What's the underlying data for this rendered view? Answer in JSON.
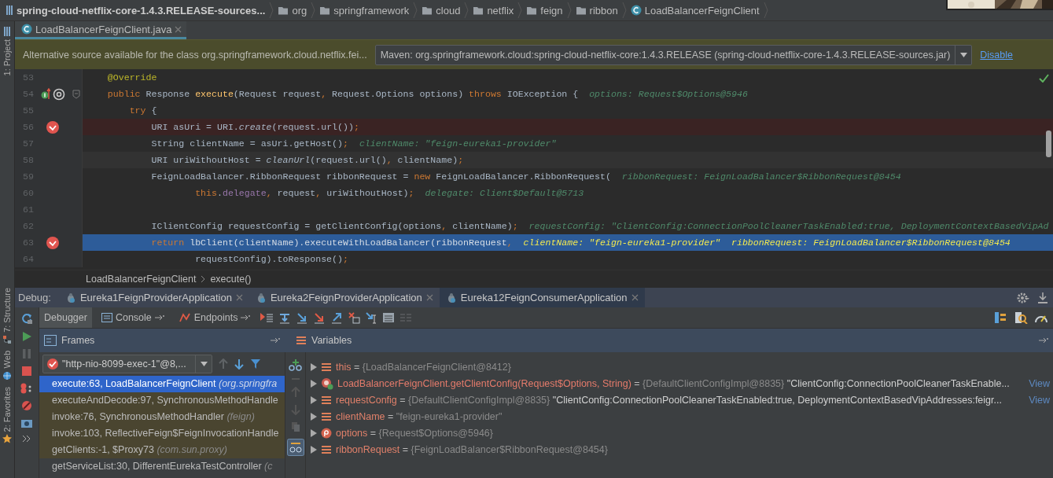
{
  "breadcrumb": [
    {
      "kind": "project",
      "label": "spring-cloud-netflix-core-1.4.3.RELEASE-sources..."
    },
    {
      "kind": "folder",
      "label": "org"
    },
    {
      "kind": "folder",
      "label": "springframework"
    },
    {
      "kind": "folder",
      "label": "cloud"
    },
    {
      "kind": "folder",
      "label": "netflix"
    },
    {
      "kind": "folder",
      "label": "feign"
    },
    {
      "kind": "folder",
      "label": "ribbon"
    },
    {
      "kind": "class",
      "label": "LoadBalancerFeignClient"
    }
  ],
  "tool_strip": [
    {
      "label": "1: Project",
      "kind": "project"
    },
    {
      "label": "7: Structure",
      "kind": "structure"
    },
    {
      "label": "Web",
      "kind": "web"
    },
    {
      "label": "2: Favorites",
      "kind": "favorites"
    }
  ],
  "editor_tabs": [
    {
      "label": "LoadBalancerFeignClient.java",
      "selected": true
    }
  ],
  "notification": {
    "message": "Alternative source available for the class org.springframework.cloud.netflix.fei...",
    "source": "Maven: org.springframework.cloud:spring-cloud-netflix-core:1.4.3.RELEASE (spring-cloud-netflix-core-1.4.3.RELEASE-sources.jar)",
    "action": "Disable"
  },
  "editor": {
    "lines": [
      {
        "number": "53",
        "kind": "code",
        "breakpoint": false,
        "current": false,
        "caret": false,
        "tokens": [
          {
            "kind": "annotation",
            "text": "    @Override"
          }
        ]
      },
      {
        "number": "54",
        "kind": "header",
        "breakpoint": false,
        "current": false,
        "caret": false,
        "tokens": [
          {
            "kind": "keyword",
            "text": "    public"
          },
          {
            "kind": "plain",
            "text": " Response "
          },
          {
            "kind": "declaration",
            "text": "execute"
          },
          {
            "kind": "plain",
            "text": "(Request request"
          },
          {
            "kind": "keyword",
            "text": ","
          },
          {
            "kind": "plain",
            "text": " Request.Options options) "
          },
          {
            "kind": "keyword",
            "text": "throws"
          },
          {
            "kind": "plain",
            "text": " IOException {"
          }
        ],
        "hints": [
          "options: Request$Options@5946"
        ]
      },
      {
        "number": "55",
        "kind": "code",
        "breakpoint": false,
        "current": false,
        "caret": false,
        "tokens": [
          {
            "kind": "keyword",
            "text": "        try"
          },
          {
            "kind": "plain",
            "text": " {"
          }
        ]
      },
      {
        "number": "56",
        "kind": "code",
        "breakpoint": true,
        "current": false,
        "caret": false,
        "tokens": [
          {
            "kind": "plain",
            "text": "            URI asUri = URI."
          },
          {
            "kind": "static",
            "text": "create"
          },
          {
            "kind": "plain",
            "text": "(request.url())"
          },
          {
            "kind": "keyword",
            "text": ";"
          }
        ]
      },
      {
        "number": "57",
        "kind": "code",
        "breakpoint": false,
        "current": false,
        "caret": false,
        "tokens": [
          {
            "kind": "plain",
            "text": "            String clientName = asUri.getHost()"
          },
          {
            "kind": "keyword",
            "text": ";"
          }
        ],
        "hints": [
          "clientName: \"feign-eureka1-provider\""
        ]
      },
      {
        "number": "58",
        "kind": "code",
        "breakpoint": false,
        "current": false,
        "caret": true,
        "tokens": [
          {
            "kind": "plain",
            "text": "            URI uriWithoutHost = "
          },
          {
            "kind": "static",
            "text": "cleanUrl"
          },
          {
            "kind": "plain",
            "text": "(request.url()"
          },
          {
            "kind": "keyword",
            "text": ","
          },
          {
            "kind": "plain",
            "text": " clientName)"
          },
          {
            "kind": "keyword",
            "text": ";"
          }
        ]
      },
      {
        "number": "59",
        "kind": "code",
        "breakpoint": false,
        "current": false,
        "caret": false,
        "tokens": [
          {
            "kind": "plain",
            "text": "            FeignLoadBalancer.RibbonRequest ribbonRequest = "
          },
          {
            "kind": "keyword",
            "text": "new"
          },
          {
            "kind": "plain",
            "text": " FeignLoadBalancer.RibbonRequest("
          }
        ],
        "hints": [
          "ribbonRequest: FeignLoadBalancer$RibbonRequest@8454"
        ]
      },
      {
        "number": "60",
        "kind": "code",
        "breakpoint": false,
        "current": false,
        "caret": false,
        "tokens": [
          {
            "kind": "keyword",
            "text": "                    this"
          },
          {
            "kind": "plain",
            "text": "."
          },
          {
            "kind": "field",
            "text": "delegate"
          },
          {
            "kind": "keyword",
            "text": ","
          },
          {
            "kind": "plain",
            "text": " request"
          },
          {
            "kind": "keyword",
            "text": ","
          },
          {
            "kind": "plain",
            "text": " uriWithoutHost)"
          },
          {
            "kind": "keyword",
            "text": ";"
          }
        ],
        "hints": [
          "delegate: Client$Default@5713"
        ]
      },
      {
        "number": "61",
        "kind": "code",
        "breakpoint": false,
        "current": false,
        "caret": false
      },
      {
        "number": "62",
        "kind": "code",
        "breakpoint": false,
        "current": false,
        "caret": false,
        "tokens": [
          {
            "kind": "plain",
            "text": "            IClientConfig requestConfig = getClientConfig(options"
          },
          {
            "kind": "keyword",
            "text": ","
          },
          {
            "kind": "plain",
            "text": " clientName)"
          },
          {
            "kind": "keyword",
            "text": ";"
          }
        ],
        "hints": [
          "requestConfig: \"ClientConfig:ConnectionPoolCleanerTaskEnabled:true, DeploymentContextBasedVipAd"
        ]
      },
      {
        "number": "63",
        "kind": "code",
        "breakpoint": true,
        "current": true,
        "caret": false,
        "tokens": [
          {
            "kind": "keyword",
            "text": "            return"
          },
          {
            "kind": "plain",
            "text": " lbClient(clientName).executeWithLoadBalancer(ribbonRequest"
          },
          {
            "kind": "keyword",
            "text": ","
          }
        ],
        "hints": [
          "clientName: \"feign-eureka1-provider\"",
          "ribbonRequest: FeignLoadBalancer$RibbonRequest@8454"
        ]
      },
      {
        "number": "64",
        "kind": "code",
        "breakpoint": false,
        "current": false,
        "caret": false,
        "tokens": [
          {
            "kind": "plain",
            "text": "                    requestConfig).toResponse()"
          },
          {
            "kind": "keyword",
            "text": ";"
          }
        ]
      }
    ]
  },
  "code_breadcrumb": [
    "LoadBalancerFeignClient",
    "execute()"
  ],
  "debug": {
    "title": "Debug:",
    "tabs": [
      {
        "label": "Eureka1FeignProviderApplication",
        "selected": false
      },
      {
        "label": "Eureka2FeignProviderApplication",
        "selected": false
      },
      {
        "label": "Eureka12FeignConsumerApplication",
        "selected": true
      }
    ],
    "views": [
      {
        "label": "Debugger",
        "selected": true
      },
      {
        "label": "Console",
        "selected": false
      },
      {
        "label": "Endpoints",
        "selected": false
      }
    ],
    "frames": {
      "title": "Frames",
      "thread": "\"http-nio-8099-exec-1\"@8,...",
      "items": [
        {
          "method": "execute:63, LoadBalancerFeignClient",
          "package": "(org.springfra",
          "selected": true,
          "library": false
        },
        {
          "method": "executeAndDecode:97, SynchronousMethodHandle",
          "selected": false,
          "library": true
        },
        {
          "method": "invoke:76, SynchronousMethodHandler",
          "package": "(feign)",
          "selected": false,
          "library": true
        },
        {
          "method": "invoke:103, ReflectiveFeign$FeignInvocationHandle",
          "selected": false,
          "library": true
        },
        {
          "method": "getClients:-1, $Proxy73",
          "package": "(com.sun.proxy)",
          "selected": false,
          "library": true
        },
        {
          "method": "getServiceList:30, DifferentEurekaTestController",
          "package": "(c",
          "selected": false,
          "library": false
        }
      ]
    },
    "variables": {
      "title": "Variables",
      "items": [
        {
          "kind": "field",
          "expanded": false,
          "name": "this",
          "sign": "=",
          "value": "{LoadBalancerFeignClient@8412}"
        },
        {
          "kind": "method",
          "expanded": false,
          "name": "LoadBalancerFeignClient.getClientConfig(Request$Options, String)",
          "sign": "=",
          "value": "{DefaultClientConfigImpl@8835}",
          "text": "\"ClientConfig:ConnectionPoolCleanerTaskEnable...",
          "link": "View"
        },
        {
          "kind": "field",
          "expanded": false,
          "name": "requestConfig",
          "sign": "=",
          "value": "{DefaultClientConfigImpl@8835}",
          "text": "\"ClientConfig:ConnectionPoolCleanerTaskEnabled:true, DeploymentContextBasedVipAddresses:feigr...",
          "link": "View"
        },
        {
          "kind": "field",
          "expanded": false,
          "name": "clientName",
          "sign": "=",
          "value": "\"feign-eureka1-provider\""
        },
        {
          "kind": "parameter",
          "expanded": false,
          "name": "options",
          "sign": "=",
          "value": "{Request$Options@5946}"
        },
        {
          "kind": "field",
          "expanded": false,
          "name": "ribbonRequest",
          "sign": "=",
          "value": "{FeignLoadBalancer$RibbonRequest@8454}"
        }
      ]
    }
  }
}
